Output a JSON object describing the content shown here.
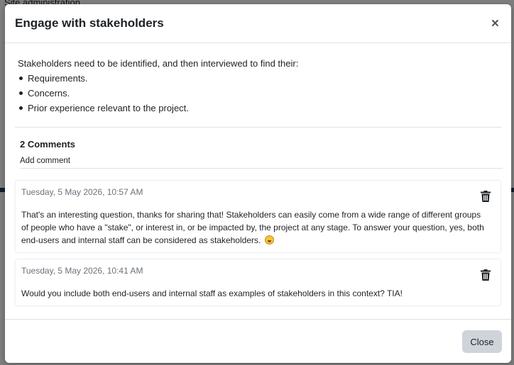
{
  "background": {
    "text_top": "Site administration"
  },
  "modal": {
    "title": "Engage with stakeholders",
    "close_icon": "close-icon",
    "intro": "Stakeholders need to be identified, and then interviewed to find their:",
    "bullets": [
      "Requirements.",
      "Concerns.",
      "Prior experience relevant to the project."
    ],
    "comments_heading": "2 Comments",
    "add_comment": "Add comment",
    "comments": [
      {
        "date": "Tuesday, 5 May 2026, 10:57 AM",
        "text": "That's an interesting question, thanks for sharing that! Stakeholders can easily come from a wide range of different groups of people who have a \"stake\", or interest in, or be impacted by, the project at any stage. To answer your question, yes, both end-users and internal staff can be considered as stakeholders.",
        "emoji": "smiling-face-icon",
        "delete_icon": "trash-icon"
      },
      {
        "date": "Tuesday, 5 May 2026, 10:41 AM",
        "text": "Would you include both end-users and internal staff as examples of stakeholders in this context? TIA!",
        "delete_icon": "trash-icon"
      }
    ],
    "footer_close": "Close"
  },
  "colors": {
    "backdrop_dim": "rgba(0,0,0,0.5)",
    "close_button_bg": "#ced4da",
    "date_text": "#6a737b"
  }
}
